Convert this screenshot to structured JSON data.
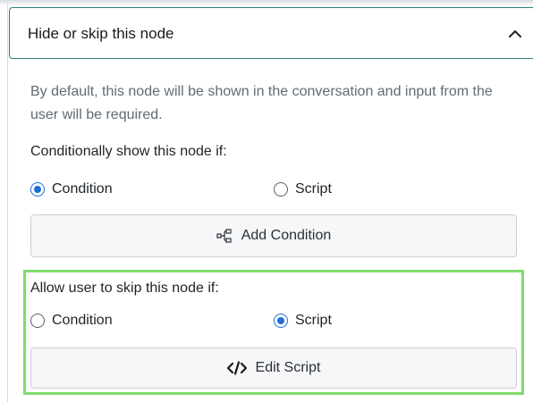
{
  "section": {
    "title": "Hide or skip this node",
    "chevron_icon": "chevron-up-icon"
  },
  "description": "By default, this node will be shown in the conversation and input from the user will be required.",
  "show_group": {
    "label": "Conditionally show this node if:",
    "options": [
      {
        "label": "Condition",
        "checked": true
      },
      {
        "label": "Script",
        "checked": false
      }
    ],
    "button": {
      "label": "Add Condition",
      "icon": "flow-condition-icon"
    }
  },
  "skip_group": {
    "label": "Allow user to skip this node if:",
    "options": [
      {
        "label": "Condition",
        "checked": false
      },
      {
        "label": "Script",
        "checked": true
      }
    ],
    "button": {
      "label": "Edit Script",
      "icon": "code-icon"
    }
  },
  "colors": {
    "header_border": "#2e7d7a",
    "radio_selected": "#1d6fd8",
    "highlight": "#7edc6e"
  }
}
